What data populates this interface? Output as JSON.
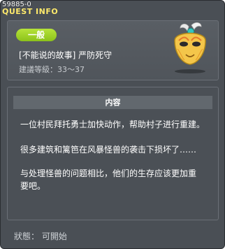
{
  "window": {
    "quest_id": "59885-0",
    "title": "QUEST INFO"
  },
  "header": {
    "category": "一般",
    "quest_title": "[不能说的故事] 严防死守",
    "level_recommendation": "建議等級：33～37",
    "icon": "golden-mask-icon"
  },
  "content": {
    "section_title": "内容",
    "paragraphs": [
      "一位村民拜托勇士加快动作，帮助村子进行重建。",
      "很多建筑和篱笆在风暴怪兽的袭击下损坏了……",
      "与处理怪兽的问题相比，他们的生存应该更加重要吧。"
    ]
  },
  "footer": {
    "status": "狀態： 可開始"
  },
  "colors": {
    "title": "#ffea6b",
    "badge": "#9fd02a",
    "panel_bg": "#4a4f55"
  }
}
